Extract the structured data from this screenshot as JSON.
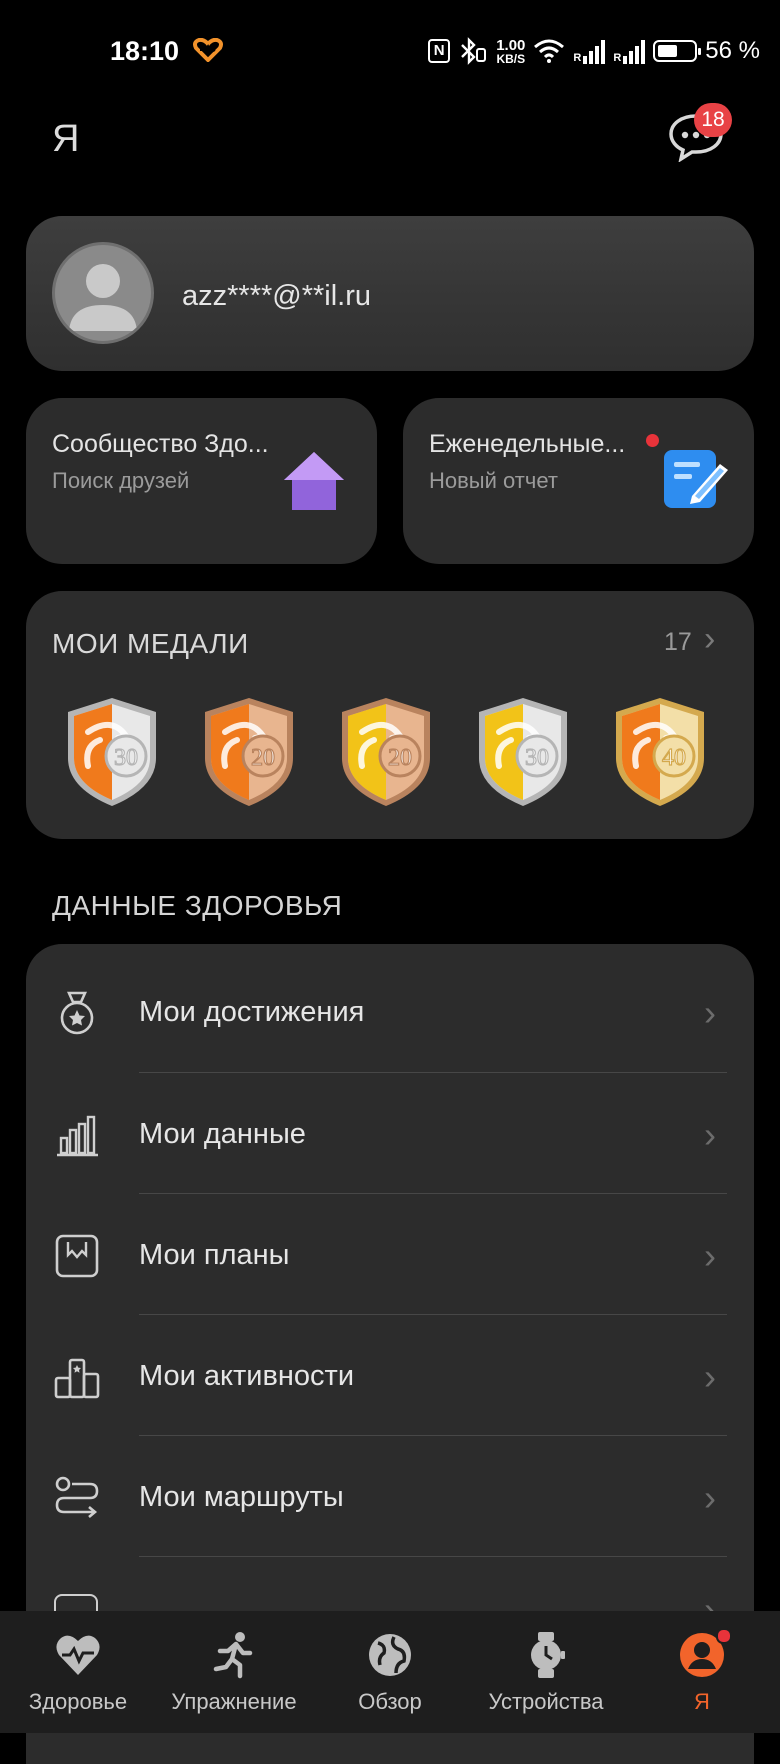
{
  "status_bar": {
    "time": "18:10",
    "nfc": "N",
    "speed_value": "1.00",
    "speed_unit": "KB/S",
    "sim1": "R",
    "sim2": "R",
    "battery": "56 %"
  },
  "header": {
    "title": "Я",
    "messages_badge": "18"
  },
  "profile": {
    "email": "azz****@**il.ru"
  },
  "cards": [
    {
      "title": "Сообщество Здо...",
      "subtitle": "Поиск друзей",
      "icon": "house-icon"
    },
    {
      "title": "Еженедельные...",
      "subtitle": "Новый отчет",
      "icon": "report-icon"
    }
  ],
  "medals": {
    "title": "МОИ МЕДАЛИ",
    "count": "17",
    "items": [
      {
        "label": "30",
        "style": "orange-silver"
      },
      {
        "label": "20",
        "style": "orange-bronze"
      },
      {
        "label": "20",
        "style": "yellow-bronze"
      },
      {
        "label": "30",
        "style": "yellow-silver"
      },
      {
        "label": "40",
        "style": "orange-gold"
      }
    ]
  },
  "health_section": {
    "title": "ДАННЫЕ ЗДОРОВЬЯ",
    "items": [
      {
        "label": "Мои достижения",
        "icon": "medal-icon"
      },
      {
        "label": "Мои данные",
        "icon": "bar-chart-icon"
      },
      {
        "label": "Мои планы",
        "icon": "plan-icon"
      },
      {
        "label": "Мои активности",
        "icon": "podium-icon"
      },
      {
        "label": "Мои маршруты",
        "icon": "route-icon"
      }
    ]
  },
  "bottom_nav": [
    {
      "label": "Здоровье",
      "icon": "heart-pulse-icon",
      "active": false
    },
    {
      "label": "Упражнение",
      "icon": "runner-icon",
      "active": false
    },
    {
      "label": "Обзор",
      "icon": "globe-icon",
      "active": false
    },
    {
      "label": "Устройства",
      "icon": "watch-icon",
      "active": false
    },
    {
      "label": "Я",
      "icon": "person-icon",
      "active": true
    }
  ],
  "colors": {
    "accent": "#f2642b",
    "badge": "#e84245",
    "card": "#2c2c2c",
    "background": "#000000"
  }
}
